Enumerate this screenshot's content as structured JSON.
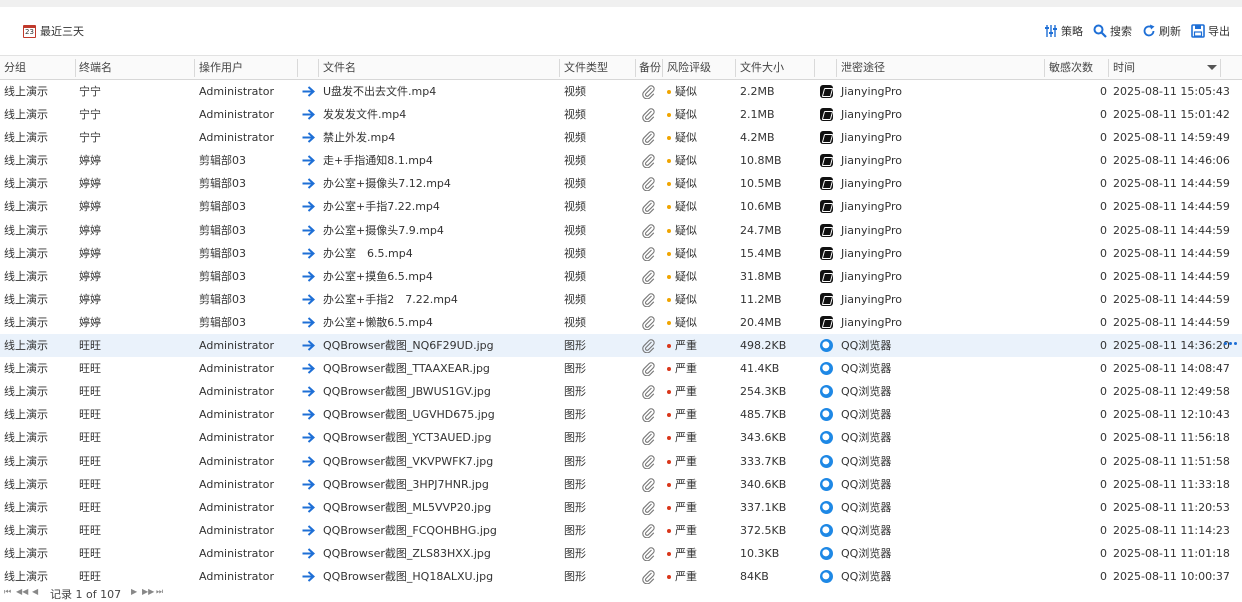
{
  "toolbar": {
    "date_range": "最近三天",
    "calendar_day": "23",
    "strategy": "策略",
    "search": "搜索",
    "refresh": "刷新",
    "export": "导出"
  },
  "columns": {
    "group": "分组",
    "terminal": "终端名",
    "user": "操作用户",
    "filename": "文件名",
    "filetype": "文件类型",
    "backup": "备份",
    "risk": "风险评级",
    "filesize": "文件大小",
    "channel": "泄密途径",
    "count": "敏感次数",
    "time": "时间"
  },
  "colors": {
    "suspicious": "#f0a500",
    "severe": "#d9361a",
    "arrow": "#1e6fd6",
    "selected_row": "#eaf2fb"
  },
  "rows": [
    {
      "group": "线上演示",
      "terminal": "宁宁",
      "user": "Administrator",
      "filename": "U盘发不出去文件.mp4",
      "filetype": "视频",
      "risk": "疑似",
      "risk_level": "suspicious",
      "size": "2.2MB",
      "app_icon": "capcut-icon",
      "channel": "JianyingPro",
      "count": "0",
      "time": "2025-08-11 15:05:43"
    },
    {
      "group": "线上演示",
      "terminal": "宁宁",
      "user": "Administrator",
      "filename": "发发发文件.mp4",
      "filetype": "视频",
      "risk": "疑似",
      "risk_level": "suspicious",
      "size": "2.1MB",
      "app_icon": "capcut-icon",
      "channel": "JianyingPro",
      "count": "0",
      "time": "2025-08-11 15:01:42"
    },
    {
      "group": "线上演示",
      "terminal": "宁宁",
      "user": "Administrator",
      "filename": "禁止外发.mp4",
      "filetype": "视频",
      "risk": "疑似",
      "risk_level": "suspicious",
      "size": "4.2MB",
      "app_icon": "capcut-icon",
      "channel": "JianyingPro",
      "count": "0",
      "time": "2025-08-11 14:59:49"
    },
    {
      "group": "线上演示",
      "terminal": "婷婷",
      "user": "剪辑部03",
      "filename": "走+手指通知8.1.mp4",
      "filetype": "视频",
      "risk": "疑似",
      "risk_level": "suspicious",
      "size": "10.8MB",
      "app_icon": "capcut-icon",
      "channel": "JianyingPro",
      "count": "0",
      "time": "2025-08-11 14:46:06"
    },
    {
      "group": "线上演示",
      "terminal": "婷婷",
      "user": "剪辑部03",
      "filename": "办公室+摄像头7.12.mp4",
      "filetype": "视频",
      "risk": "疑似",
      "risk_level": "suspicious",
      "size": "10.5MB",
      "app_icon": "capcut-icon",
      "channel": "JianyingPro",
      "count": "0",
      "time": "2025-08-11 14:44:59"
    },
    {
      "group": "线上演示",
      "terminal": "婷婷",
      "user": "剪辑部03",
      "filename": "办公室+手指7.22.mp4",
      "filetype": "视频",
      "risk": "疑似",
      "risk_level": "suspicious",
      "size": "10.6MB",
      "app_icon": "capcut-icon",
      "channel": "JianyingPro",
      "count": "0",
      "time": "2025-08-11 14:44:59"
    },
    {
      "group": "线上演示",
      "terminal": "婷婷",
      "user": "剪辑部03",
      "filename": "办公室+摄像头7.9.mp4",
      "filetype": "视频",
      "risk": "疑似",
      "risk_level": "suspicious",
      "size": "24.7MB",
      "app_icon": "capcut-icon",
      "channel": "JianyingPro",
      "count": "0",
      "time": "2025-08-11 14:44:59"
    },
    {
      "group": "线上演示",
      "terminal": "婷婷",
      "user": "剪辑部03",
      "filename": "办公室　6.5.mp4",
      "filetype": "视频",
      "risk": "疑似",
      "risk_level": "suspicious",
      "size": "15.4MB",
      "app_icon": "capcut-icon",
      "channel": "JianyingPro",
      "count": "0",
      "time": "2025-08-11 14:44:59"
    },
    {
      "group": "线上演示",
      "terminal": "婷婷",
      "user": "剪辑部03",
      "filename": "办公室+摸鱼6.5.mp4",
      "filetype": "视频",
      "risk": "疑似",
      "risk_level": "suspicious",
      "size": "31.8MB",
      "app_icon": "capcut-icon",
      "channel": "JianyingPro",
      "count": "0",
      "time": "2025-08-11 14:44:59"
    },
    {
      "group": "线上演示",
      "terminal": "婷婷",
      "user": "剪辑部03",
      "filename": "办公室+手指2　7.22.mp4",
      "filetype": "视频",
      "risk": "疑似",
      "risk_level": "suspicious",
      "size": "11.2MB",
      "app_icon": "capcut-icon",
      "channel": "JianyingPro",
      "count": "0",
      "time": "2025-08-11 14:44:59"
    },
    {
      "group": "线上演示",
      "terminal": "婷婷",
      "user": "剪辑部03",
      "filename": "办公室+懒散6.5.mp4",
      "filetype": "视频",
      "risk": "疑似",
      "risk_level": "suspicious",
      "size": "20.4MB",
      "app_icon": "capcut-icon",
      "channel": "JianyingPro",
      "count": "0",
      "time": "2025-08-11 14:44:59"
    },
    {
      "group": "线上演示",
      "terminal": "旺旺",
      "user": "Administrator",
      "filename": "QQBrowser截图_NQ6F29UD.jpg",
      "filetype": "图形",
      "risk": "严重",
      "risk_level": "severe",
      "size": "498.2KB",
      "app_icon": "qqbrowser-icon",
      "channel": "QQ浏览器",
      "count": "0",
      "time": "2025-08-11 14:36:20",
      "selected": true
    },
    {
      "group": "线上演示",
      "terminal": "旺旺",
      "user": "Administrator",
      "filename": "QQBrowser截图_TTAAXEAR.jpg",
      "filetype": "图形",
      "risk": "严重",
      "risk_level": "severe",
      "size": "41.4KB",
      "app_icon": "qqbrowser-icon",
      "channel": "QQ浏览器",
      "count": "0",
      "time": "2025-08-11 14:08:47"
    },
    {
      "group": "线上演示",
      "terminal": "旺旺",
      "user": "Administrator",
      "filename": "QQBrowser截图_JBWUS1GV.jpg",
      "filetype": "图形",
      "risk": "严重",
      "risk_level": "severe",
      "size": "254.3KB",
      "app_icon": "qqbrowser-icon",
      "channel": "QQ浏览器",
      "count": "0",
      "time": "2025-08-11 12:49:58"
    },
    {
      "group": "线上演示",
      "terminal": "旺旺",
      "user": "Administrator",
      "filename": "QQBrowser截图_UGVHD675.jpg",
      "filetype": "图形",
      "risk": "严重",
      "risk_level": "severe",
      "size": "485.7KB",
      "app_icon": "qqbrowser-icon",
      "channel": "QQ浏览器",
      "count": "0",
      "time": "2025-08-11 12:10:43"
    },
    {
      "group": "线上演示",
      "terminal": "旺旺",
      "user": "Administrator",
      "filename": "QQBrowser截图_YCT3AUED.jpg",
      "filetype": "图形",
      "risk": "严重",
      "risk_level": "severe",
      "size": "343.6KB",
      "app_icon": "qqbrowser-icon",
      "channel": "QQ浏览器",
      "count": "0",
      "time": "2025-08-11 11:56:18"
    },
    {
      "group": "线上演示",
      "terminal": "旺旺",
      "user": "Administrator",
      "filename": "QQBrowser截图_VKVPWFK7.jpg",
      "filetype": "图形",
      "risk": "严重",
      "risk_level": "severe",
      "size": "333.7KB",
      "app_icon": "qqbrowser-icon",
      "channel": "QQ浏览器",
      "count": "0",
      "time": "2025-08-11 11:51:58"
    },
    {
      "group": "线上演示",
      "terminal": "旺旺",
      "user": "Administrator",
      "filename": "QQBrowser截图_3HPJ7HNR.jpg",
      "filetype": "图形",
      "risk": "严重",
      "risk_level": "severe",
      "size": "340.6KB",
      "app_icon": "qqbrowser-icon",
      "channel": "QQ浏览器",
      "count": "0",
      "time": "2025-08-11 11:33:18"
    },
    {
      "group": "线上演示",
      "terminal": "旺旺",
      "user": "Administrator",
      "filename": "QQBrowser截图_ML5VVP20.jpg",
      "filetype": "图形",
      "risk": "严重",
      "risk_level": "severe",
      "size": "337.1KB",
      "app_icon": "qqbrowser-icon",
      "channel": "QQ浏览器",
      "count": "0",
      "time": "2025-08-11 11:20:53"
    },
    {
      "group": "线上演示",
      "terminal": "旺旺",
      "user": "Administrator",
      "filename": "QQBrowser截图_FCQOHBHG.jpg",
      "filetype": "图形",
      "risk": "严重",
      "risk_level": "severe",
      "size": "372.5KB",
      "app_icon": "qqbrowser-icon",
      "channel": "QQ浏览器",
      "count": "0",
      "time": "2025-08-11 11:14:23"
    },
    {
      "group": "线上演示",
      "terminal": "旺旺",
      "user": "Administrator",
      "filename": "QQBrowser截图_ZLS83HXX.jpg",
      "filetype": "图形",
      "risk": "严重",
      "risk_level": "severe",
      "size": "10.3KB",
      "app_icon": "qqbrowser-icon",
      "channel": "QQ浏览器",
      "count": "0",
      "time": "2025-08-11 11:01:18"
    },
    {
      "group": "线上演示",
      "terminal": "旺旺",
      "user": "Administrator",
      "filename": "QQBrowser截图_HQ18ALXU.jpg",
      "filetype": "图形",
      "risk": "严重",
      "risk_level": "severe",
      "size": "84KB",
      "app_icon": "qqbrowser-icon",
      "channel": "QQ浏览器",
      "count": "0",
      "time": "2025-08-11 10:00:37"
    }
  ],
  "pager": {
    "text": "记录 1 of 107",
    "first": "⏮",
    "prev_page": "◀◀",
    "prev": "◀",
    "next": "▶",
    "next_page": "▶▶",
    "last": "⏭"
  }
}
